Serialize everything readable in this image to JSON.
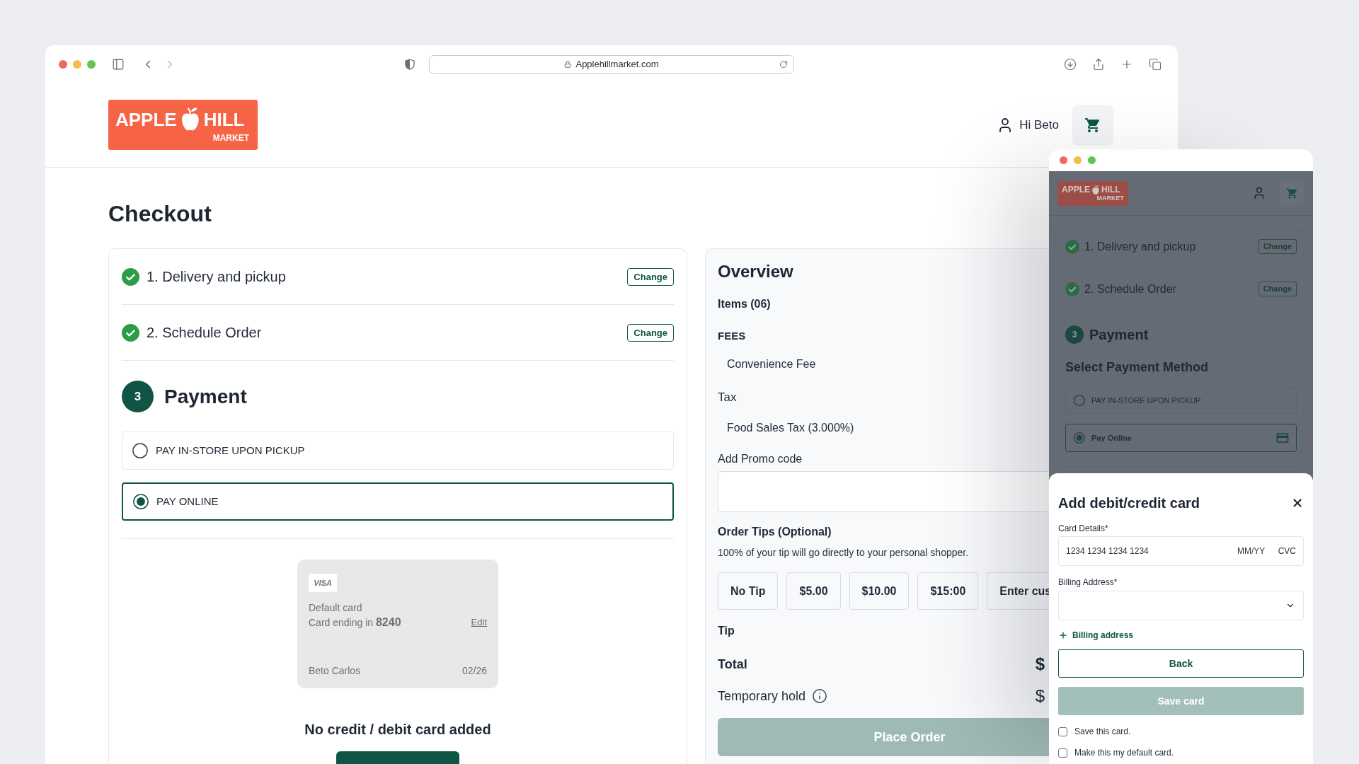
{
  "browser": {
    "url": "Applehillmarket.com"
  },
  "header": {
    "logo": {
      "name_start": "APPLE",
      "name_end": "HILL",
      "tagline": "MARKET"
    },
    "greeting": "Hi Beto"
  },
  "page_title": "Checkout",
  "steps": [
    {
      "label": "1. Delivery and pickup",
      "completed": true,
      "action": "Change"
    },
    {
      "label": "2. Schedule Order",
      "completed": true,
      "action": "Change"
    }
  ],
  "payment": {
    "number": "3",
    "title": "Payment",
    "options": [
      {
        "label": "PAY IN-STORE UPON PICKUP",
        "selected": false
      },
      {
        "label": "PAY ONLINE",
        "selected": true
      }
    ],
    "card_preview": {
      "brand": "VISA",
      "caption": "Default card",
      "ending": "Card ending in **8240**",
      "edit": "Edit",
      "holder": "Beto Carlos",
      "expiry": "02/26"
    },
    "empty_message": "No credit / debit card added"
  },
  "overview": {
    "title": "Overview",
    "items": "Items (06)",
    "fees_heading": "FEES",
    "fees": [
      "Convenience Fee"
    ],
    "tax_heading": "Tax",
    "taxes": [
      "Food Sales Tax (3.000%)"
    ],
    "promo_label": "Add Promo code",
    "tips_heading": "Order Tips (Optional)",
    "tips_note": "100% of your tip will go directly to your personal shopper.",
    "tip_options": [
      {
        "label": "No Tip",
        "selected": false
      },
      {
        "label": "$5.00",
        "selected": false
      },
      {
        "label": "$10.00",
        "selected": false
      },
      {
        "label": "$15:00",
        "selected": false
      },
      {
        "label": "Enter cus",
        "selected": false
      }
    ],
    "tip_label": "Tip",
    "total_label": "Total",
    "total_value": "$",
    "hold_label": "Temporary hold",
    "hold_value": "$",
    "place_order": {
      "label": "Place Order",
      "disabled": true
    }
  },
  "mobile_preview": {
    "logo": {
      "name_start": "APPLE",
      "name_end": "HILL",
      "tagline": "MARKET"
    },
    "steps": [
      {
        "label": "1. Delivery and pickup",
        "completed": true,
        "action": "Change"
      },
      {
        "label": "2. Schedule Order",
        "completed": true,
        "action": "Change"
      }
    ],
    "payment_number": "3",
    "payment_title": "Payment",
    "method_heading": "Select Payment Method",
    "options": [
      {
        "label": "PAY IN-STORE UPON PICKUP",
        "selected": false,
        "kind": "pickup"
      },
      {
        "label": "Pay Online",
        "selected": true,
        "kind": "card"
      }
    ],
    "card_dialog": {
      "title": "Add debit/credit card",
      "card_label": "Card Details*",
      "card_number_placeholder": "1234 1234 1234 1234",
      "expiry_placeholder": "MM/YY",
      "cvc_placeholder": "CVC",
      "billing_label": "Billing Address*",
      "add_billing": "Billing address",
      "back": "Back",
      "save": {
        "label": "Save card",
        "disabled": true
      },
      "checkboxes": [
        {
          "label": "Save this card.",
          "checked": false
        },
        {
          "label": "Make this my default card.",
          "checked": false
        }
      ]
    }
  }
}
